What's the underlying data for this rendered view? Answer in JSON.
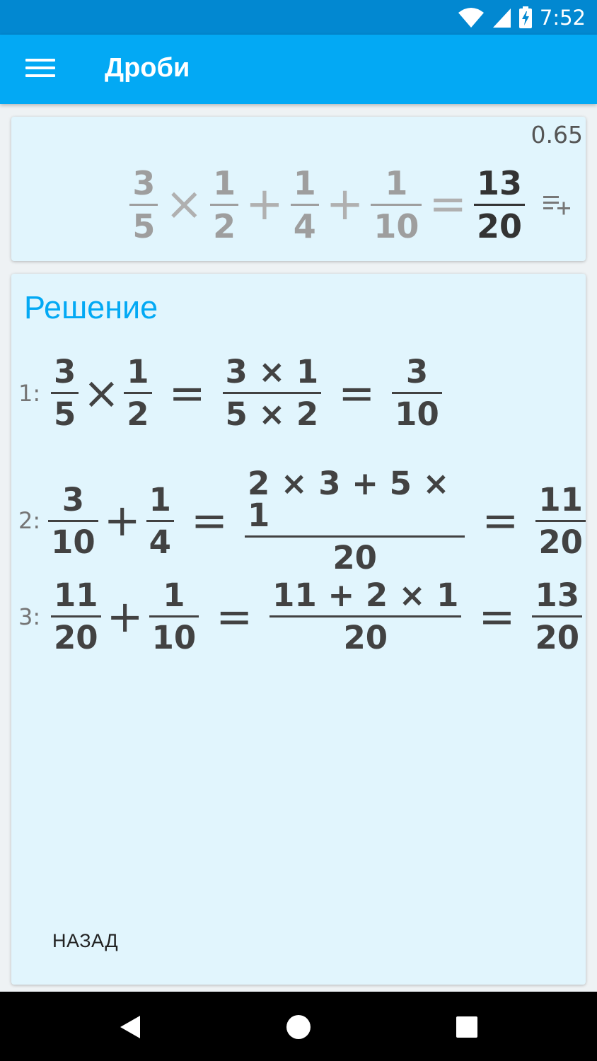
{
  "status_bar": {
    "time": "7:52",
    "icons": [
      "wifi-icon",
      "cell-signal-icon",
      "battery-charging-icon"
    ]
  },
  "app_bar": {
    "title": "Дроби",
    "menu_icon": "hamburger-menu-icon"
  },
  "input_card": {
    "decimal_value": "0.65",
    "expression": {
      "f1": {
        "num": "3",
        "den": "5"
      },
      "op1": "×",
      "f2": {
        "num": "1",
        "den": "2"
      },
      "op2": "+",
      "f3": {
        "num": "1",
        "den": "4"
      },
      "op3": "+",
      "f4": {
        "num": "1",
        "den": "10"
      },
      "eq": "=",
      "result": {
        "num": "13",
        "den": "20"
      }
    },
    "add_line_icon": "playlist-add-icon"
  },
  "solution": {
    "title": "Решение",
    "back_label": "НАЗАД",
    "steps": [
      {
        "label": "1:",
        "a": {
          "num": "3",
          "den": "5"
        },
        "op": "×",
        "b": {
          "num": "1",
          "den": "2"
        },
        "eq1": "=",
        "work": {
          "num": "3 × 1",
          "den": "5 × 2"
        },
        "eq2": "=",
        "result": {
          "num": "3",
          "den": "10"
        }
      },
      {
        "label": "2:",
        "a": {
          "num": "3",
          "den": "10"
        },
        "op": "+",
        "b": {
          "num": "1",
          "den": "4"
        },
        "eq1": "=",
        "work": {
          "num": "2 × 3 + 5 × 1",
          "den": "20"
        },
        "eq2": "=",
        "result": {
          "num": "11",
          "den": "20"
        }
      },
      {
        "label": "3:",
        "a": {
          "num": "11",
          "den": "20"
        },
        "op": "+",
        "b": {
          "num": "1",
          "den": "10"
        },
        "eq1": "=",
        "work": {
          "num": "11 + 2 × 1",
          "den": "20"
        },
        "eq2": "=",
        "result": {
          "num": "13",
          "den": "20"
        }
      }
    ]
  },
  "nav_bar": {
    "icons": [
      "back-triangle-icon",
      "home-circle-icon",
      "recents-square-icon"
    ]
  },
  "colors": {
    "status_bar": "#0288d1",
    "app_bar": "#03a9f4",
    "card_bg": "#e1f5fd",
    "accent": "#03a9f4",
    "formula_gray": "#9e9e9e",
    "formula_dark": "#424242"
  }
}
